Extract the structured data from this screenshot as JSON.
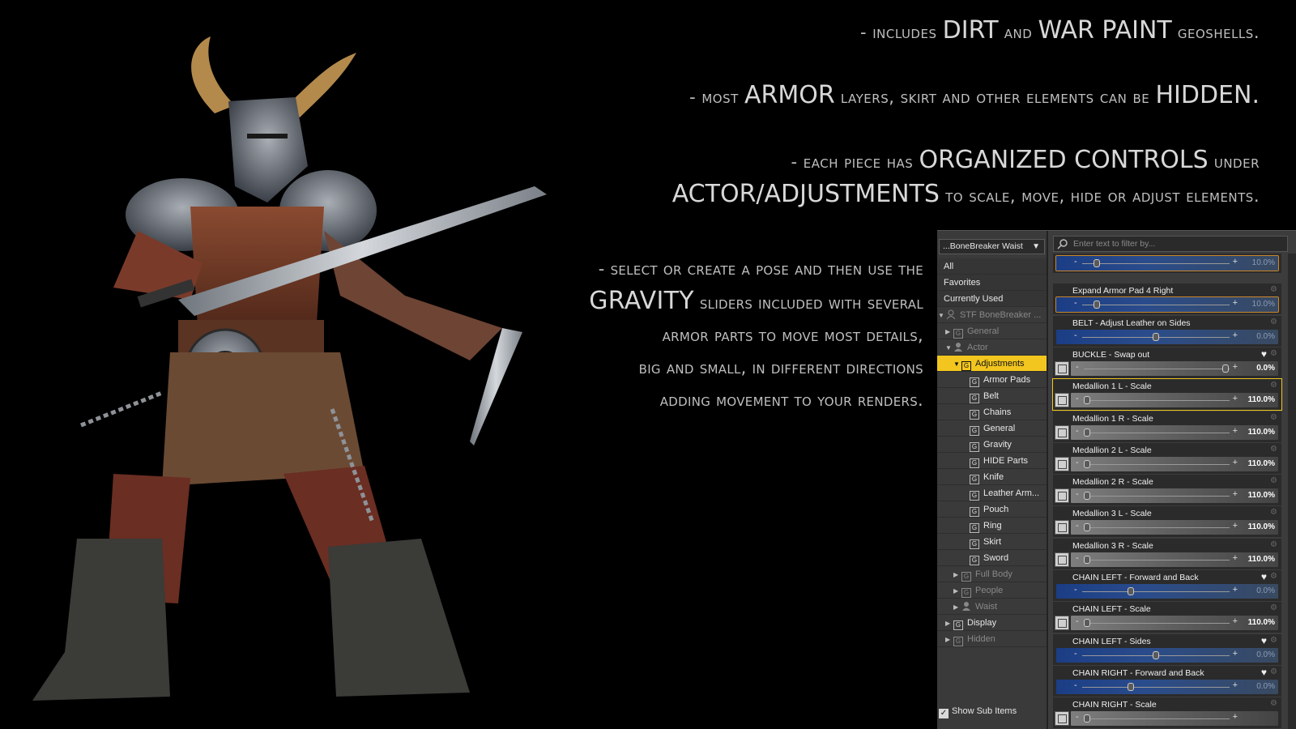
{
  "promo": {
    "l1_a": "- includes ",
    "l1_b": "DIRT",
    "l1_c": " and ",
    "l1_d": "WAR PAINT",
    "l1_e": " geoshells.",
    "l2_a": "- most ",
    "l2_b": "ARMOR",
    "l2_c": " layers, skirt and other elements can be ",
    "l2_d": "HIDDEN.",
    "l3_a": "- each piece has ",
    "l3_b": "ORGANIZED CONTROLS",
    "l3_c": " under",
    "l4_a": "ACTOR/ADJUSTMENTS",
    "l4_b": " to scale, move, hide or adjust elements.",
    "g_1": "- select or create a pose and then use the",
    "g_2a": "GRAVITY",
    "g_2b": " sliders included with several",
    "g_3": "armor parts to move most details,",
    "g_4": "big and small, in different directions",
    "g_5": "adding movement to your renders."
  },
  "tree": {
    "node_select": "...BoneBreaker Waist",
    "top_items": [
      "All",
      "Favorites",
      "Currently Used"
    ],
    "root": "STF BoneBreaker ...",
    "general": "General",
    "actor": "Actor",
    "adjustments": "Adjustments",
    "children": [
      "Armor Pads",
      "Belt",
      "Chains",
      "General",
      "Gravity",
      "HIDE Parts",
      "Knife",
      "Leather Arm...",
      "Pouch",
      "Ring",
      "Skirt",
      "Sword"
    ],
    "full_body": "Full Body",
    "people": "People",
    "waist": "Waist",
    "display": "Display",
    "hidden": "Hidden",
    "show_sub": "Show Sub Items"
  },
  "filter": {
    "placeholder": "Enter text to filter by..."
  },
  "properties": [
    {
      "label": "",
      "value": "10.0%",
      "style": "blue",
      "pos": 0.1
    },
    {
      "label": "Expand Armor Pad 4 Right",
      "value": "10.0%",
      "style": "blue",
      "pos": 0.1
    },
    {
      "label": "BELT - Adjust Leather on Sides",
      "value": "0.0%",
      "style": "blue",
      "pos": 0.5
    },
    {
      "label": "BUCKLE - Swap out",
      "value": "0.0%",
      "style": "gray",
      "pos": 0.97
    },
    {
      "label": "Medallion 1 L - Scale",
      "value": "110.0%",
      "style": "gray",
      "pos": 0.02
    },
    {
      "label": "Medallion 1 R - Scale",
      "value": "110.0%",
      "style": "gray",
      "pos": 0.02
    },
    {
      "label": "Medallion 2 L - Scale",
      "value": "110.0%",
      "style": "gray",
      "pos": 0.02
    },
    {
      "label": "Medallion 2 R - Scale",
      "value": "110.0%",
      "style": "gray",
      "pos": 0.02
    },
    {
      "label": "Medallion 3 L - Scale",
      "value": "110.0%",
      "style": "gray",
      "pos": 0.02
    },
    {
      "label": "Medallion 3 R - Scale",
      "value": "110.0%",
      "style": "gray",
      "pos": 0.02
    },
    {
      "label": "CHAIN LEFT - Forward and Back",
      "value": "0.0%",
      "style": "blue",
      "pos": 0.33
    },
    {
      "label": "CHAIN LEFT - Scale",
      "value": "110.0%",
      "style": "gray",
      "pos": 0.02
    },
    {
      "label": "CHAIN LEFT - Sides",
      "value": "0.0%",
      "style": "blue",
      "pos": 0.5
    },
    {
      "label": "CHAIN RIGHT - Forward and Back",
      "value": "0.0%",
      "style": "blue",
      "pos": 0.33
    },
    {
      "label": "CHAIN RIGHT - Scale",
      "value": "",
      "style": "gray",
      "pos": 0.02
    }
  ],
  "colors": {
    "selected": "#f2c61f",
    "slider_blue": "#1b3d85",
    "panel": "#3e3e3e"
  },
  "icons": {
    "filter": "search-icon",
    "favorite": "heart-icon",
    "settings": "gear-icon"
  }
}
